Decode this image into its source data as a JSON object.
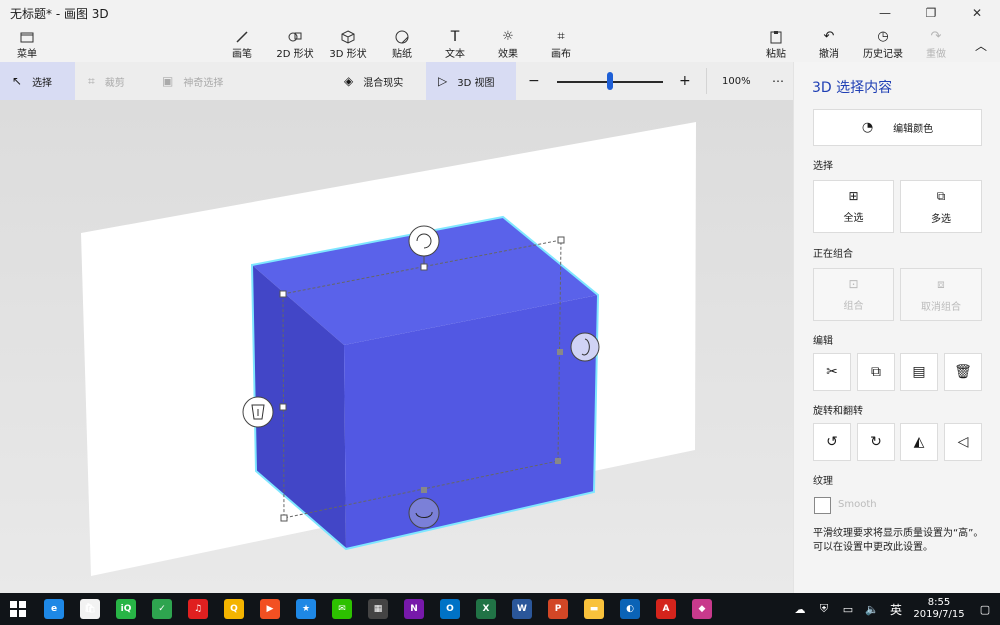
{
  "window": {
    "title": "无标题* - 画图 3D"
  },
  "ribbon": {
    "menu": "菜单",
    "tools": [
      "画笔",
      "2D 形状",
      "3D 形状",
      "贴纸",
      "文本",
      "效果",
      "画布"
    ],
    "right": [
      "粘贴",
      "撤消",
      "历史记录",
      "重做"
    ]
  },
  "toolbar": {
    "select": "选择",
    "crop": "裁剪",
    "magic_select": "神奇选择",
    "mixed_reality": "混合现实",
    "view_3d": "3D 视图",
    "zoom_value": "100%",
    "zoom_level": 0.5
  },
  "panel": {
    "title": "3D 选择内容",
    "edit_color": "编辑颜色",
    "select_label": "选择",
    "select_all": "全选",
    "multi_select": "多选",
    "grouping_label": "正在组合",
    "group": "组合",
    "ungroup": "取消组合",
    "edit_label": "编辑",
    "rotate_label": "旋转和翻转",
    "texture_label": "纹理",
    "smooth": "Smooth",
    "note": "平滑纹理要求将显示质量设置为“高”。可以在设置中更改此设置。"
  },
  "taskbar": {
    "apps": [
      {
        "icon": "edge-icon",
        "color": "#1e88e5",
        "text": "e"
      },
      {
        "icon": "store-icon",
        "color": "#f2f2f2",
        "text": "🛍"
      },
      {
        "icon": "iqiyi-icon",
        "color": "#28b446",
        "text": "iQ"
      },
      {
        "icon": "wechat-work-icon",
        "color": "#2ea44f",
        "text": "✓"
      },
      {
        "icon": "netease-music-icon",
        "color": "#e02020",
        "text": "♫"
      },
      {
        "icon": "qq-browser-icon",
        "color": "#f4b400",
        "text": "Q"
      },
      {
        "icon": "video-icon",
        "color": "#f25022",
        "text": "▶"
      },
      {
        "icon": "assistant-icon",
        "color": "#1e88e5",
        "text": "★"
      },
      {
        "icon": "wechat-icon",
        "color": "#2dc100",
        "text": "✉"
      },
      {
        "icon": "calculator-icon",
        "color": "#444444",
        "text": "▦"
      },
      {
        "icon": "onenote-icon",
        "color": "#7719aa",
        "text": "N"
      },
      {
        "icon": "outlook-icon",
        "color": "#0072c6",
        "text": "O"
      },
      {
        "icon": "excel-icon",
        "color": "#217346",
        "text": "X"
      },
      {
        "icon": "word-icon",
        "color": "#2b579a",
        "text": "W"
      },
      {
        "icon": "powerpoint-icon",
        "color": "#d24726",
        "text": "P"
      },
      {
        "icon": "file-explorer-icon",
        "color": "#f9c23c",
        "text": "▬"
      },
      {
        "icon": "photos-icon",
        "color": "#0b63b6",
        "text": "◐"
      },
      {
        "icon": "acrobat-icon",
        "color": "#d4241c",
        "text": "A"
      },
      {
        "icon": "paint3d-icon",
        "color": "#c83a8c",
        "text": "◆"
      }
    ],
    "ime": "英",
    "time": "8:55",
    "date": "2019/7/15"
  },
  "colors": {
    "accent": "#1f3fb4",
    "box_front": "#5258e3",
    "box_top": "#5a62ea",
    "box_side": "#4246c7",
    "outline": "#7fe6ff"
  }
}
